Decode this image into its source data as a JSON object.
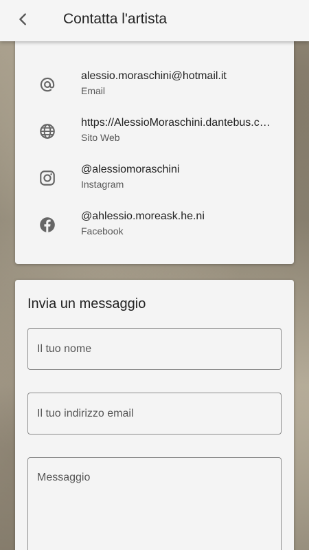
{
  "header": {
    "title": "Contatta l'artista",
    "back_icon": "chevron-left-icon"
  },
  "contacts": [
    {
      "icon": "at-sign-icon",
      "value": "alessio.moraschini@hotmail.it",
      "label": "Email"
    },
    {
      "icon": "globe-icon",
      "value": "https://AlessioMoraschini.dantebus.com",
      "label": "Sito Web"
    },
    {
      "icon": "instagram-icon",
      "value": "@alessiomoraschini",
      "label": "Instagram"
    },
    {
      "icon": "facebook-icon",
      "value": "@ahlessio.moreask.he.ni",
      "label": "Facebook"
    }
  ],
  "form": {
    "title": "Invia un messaggio",
    "name_placeholder": "Il tuo nome",
    "email_placeholder": "Il tuo indirizzo email",
    "message_placeholder": "Messaggio"
  },
  "colors": {
    "card_bg": "#f4f4f4",
    "icon": "#666666",
    "text": "#222222"
  }
}
